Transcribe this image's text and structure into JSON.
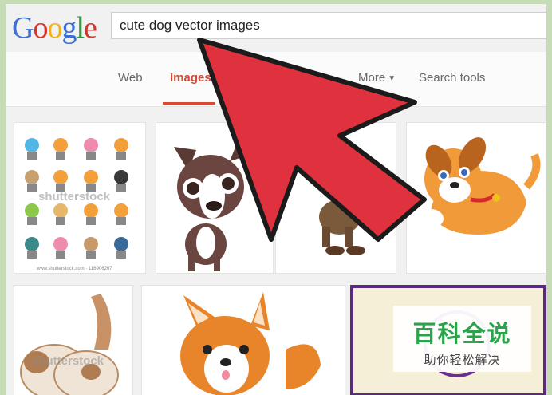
{
  "logo": {
    "letters": [
      "G",
      "o",
      "o",
      "g",
      "l",
      "e"
    ]
  },
  "search": {
    "query": "cute dog vector images"
  },
  "nav": {
    "web": "Web",
    "images": "Images",
    "more": "More",
    "search_tools": "Search tools"
  },
  "results": {
    "tile1_watermark": "shutterstock",
    "tile1_caption": "www.shutterstock.com · 116906267",
    "tile5_watermark": "shutterstock"
  },
  "badge": {
    "main": "百科全说",
    "sub": "助你轻松解决"
  },
  "colors": {
    "accent_red": "#d84a36",
    "arrow_red": "#e0323e",
    "badge_green": "#2aa34a"
  }
}
